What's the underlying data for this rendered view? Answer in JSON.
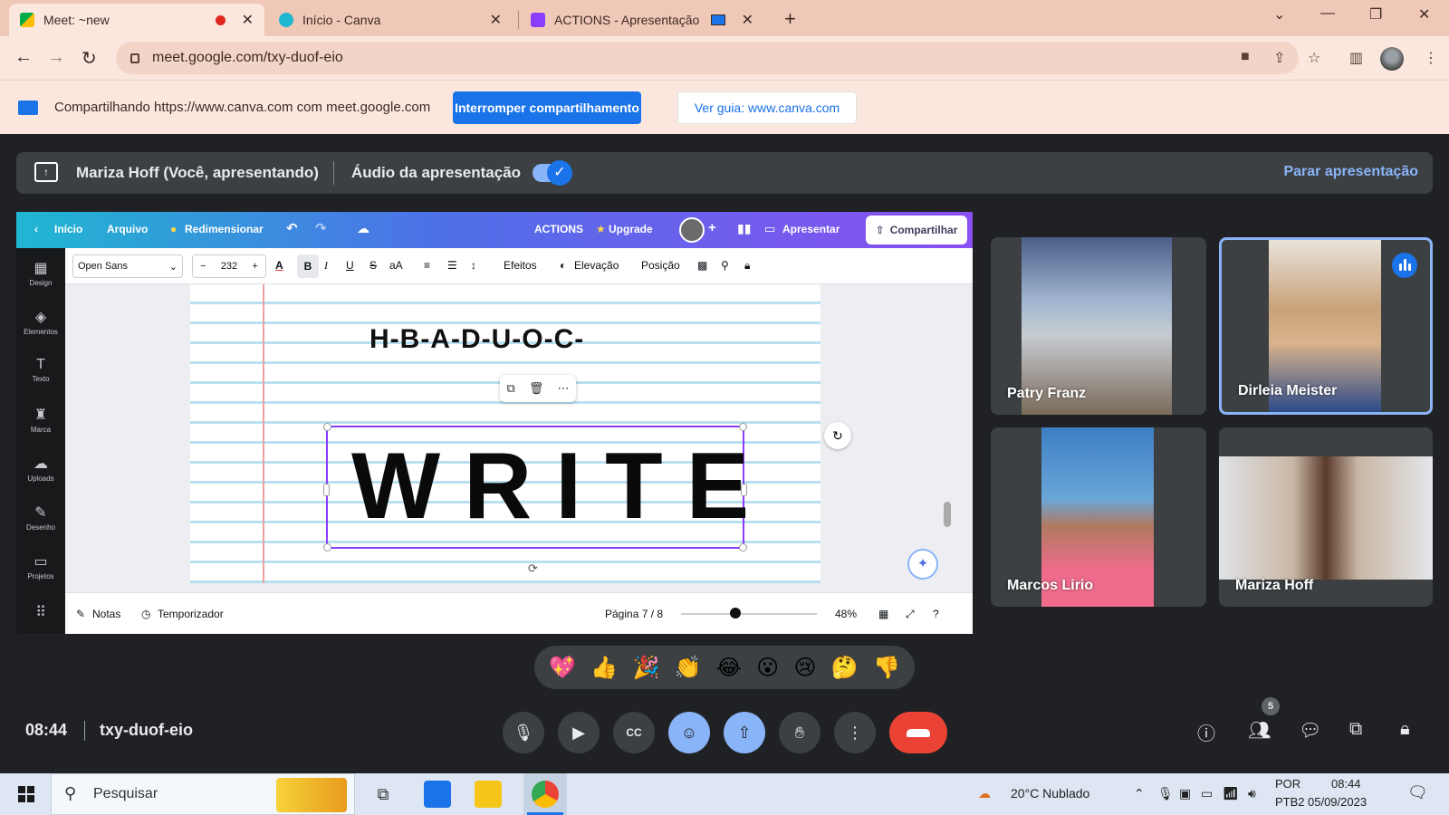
{
  "browser": {
    "tabs": [
      {
        "title": "Meet: ~new",
        "state": "recording"
      },
      {
        "title": "Início - Canva",
        "state": "normal"
      },
      {
        "title": "ACTIONS - Apresentação",
        "state": "sharing"
      }
    ],
    "new_tab": "+",
    "controls": {
      "collapse": "⌄",
      "minimize": "—",
      "restore": "❐",
      "close": "✕"
    },
    "url": "meet.google.com/txy-duof-eio",
    "icons": [
      "back-icon",
      "forward-icon",
      "reload-icon",
      "lock-icon",
      "camera-icon",
      "share-icon",
      "star-icon",
      "sidepanel-icon",
      "profile-avatar",
      "menu-icon"
    ]
  },
  "sharebar": {
    "text": "Compartilhando https://www.canva.com com meet.google.com",
    "stop_label": "Interromper compartilhamento",
    "guide_label": "Ver guia: www.canva.com"
  },
  "presenting": {
    "name": "Mariza Hoff (Você, apresentando)",
    "audio_label": "Áudio da apresentação",
    "audio_on": true,
    "stop_label": "Parar apresentação"
  },
  "canva": {
    "top": {
      "home": "Início",
      "file": "Arquivo",
      "resize": "Redimensionar",
      "design_title": "ACTIONS",
      "upgrade": "Upgrade",
      "present": "Apresentar",
      "share": "Compartilhar"
    },
    "sidebar": [
      "Design",
      "Elementos",
      "Texto",
      "Marca",
      "Uploads",
      "Desenho",
      "Projetos"
    ],
    "format": {
      "font": "Open Sans",
      "size": "232",
      "effects": "Efeitos",
      "elevation": "Elevação",
      "position": "Posição"
    },
    "page": {
      "phrase": "H-B-A-D-U-O-C-",
      "word": "WRITE"
    },
    "footer": {
      "notes": "Notas",
      "timer": "Temporizador",
      "page": "Página 7 / 8",
      "zoom": "48%",
      "zoom_level": 0.48
    }
  },
  "participants": [
    {
      "name": "Patry Franz",
      "speaking": false
    },
    {
      "name": "Dirleia Meister",
      "speaking": true
    },
    {
      "name": "Marcos Lirio",
      "speaking": false
    },
    {
      "name": "Mariza Hoff",
      "speaking": false
    }
  ],
  "reactions": [
    "💖",
    "👍",
    "🎉",
    "👏",
    "😂",
    "😮",
    "😢",
    "🤔",
    "👎"
  ],
  "call": {
    "time": "08:44",
    "code": "txy-duof-eio",
    "participant_count": "5",
    "buttons": [
      "mic-icon",
      "camera-icon",
      "captions-icon",
      "emoji-icon",
      "present-icon",
      "raise-hand-icon",
      "more-icon",
      "end-call-icon"
    ],
    "right_buttons": [
      "info-icon",
      "people-icon",
      "chat-icon",
      "activities-icon",
      "host-controls-icon"
    ]
  },
  "taskbar": {
    "search_placeholder": "Pesquisar",
    "weather": "20°C  Nublado",
    "lang_top": "POR",
    "lang_bottom": "PTB2",
    "time": "08:44",
    "date": "05/09/2023"
  },
  "colors": {
    "accent": "#1a73e8",
    "meet_dark": "#202124",
    "end_call": "#ea4335",
    "canva_purple": "#8b3dff"
  }
}
